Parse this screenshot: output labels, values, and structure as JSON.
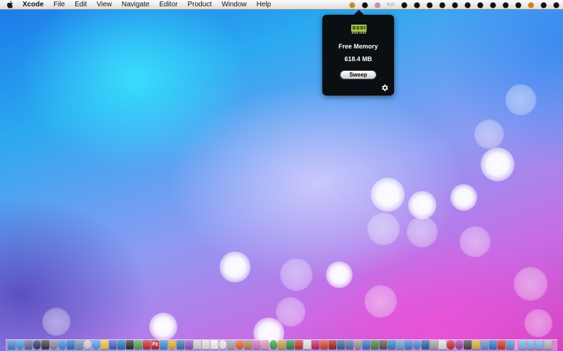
{
  "menubar": {
    "apple_icon": "apple-logo-icon",
    "items": [
      "Xcode",
      "File",
      "Edit",
      "View",
      "Navigate",
      "Editor",
      "Product",
      "Window",
      "Help"
    ],
    "status_icons": [
      {
        "name": "broom-sweep-icon",
        "color": "#c98a2a"
      },
      {
        "name": "cloud-icon",
        "color": "#111111"
      },
      {
        "name": "flower-icon",
        "color": "#c98fb0"
      },
      {
        "name": "h2o-icon",
        "glyph": "H₂O",
        "color": "#8a8a8a"
      },
      {
        "name": "wireless-broadcast-icon",
        "color": "#111111"
      },
      {
        "name": "box-icon",
        "color": "#111111"
      },
      {
        "name": "dropbox-icon",
        "color": "#111111"
      },
      {
        "name": "hand-icon",
        "color": "#111111"
      },
      {
        "name": "face-icon",
        "color": "#111111"
      },
      {
        "name": "eject-circle-icon",
        "color": "#111111"
      },
      {
        "name": "bluetooth-icon",
        "color": "#111111"
      },
      {
        "name": "battery-icon",
        "color": "#111111"
      },
      {
        "name": "binoculars-icon",
        "color": "#111111"
      },
      {
        "name": "wifi-icon",
        "color": "#111111"
      },
      {
        "name": "pen-icon",
        "color": "#d07a2a"
      },
      {
        "name": "user-circle-icon",
        "color": "#111111"
      },
      {
        "name": "spotlight-search-icon",
        "color": "#111111"
      }
    ]
  },
  "popover": {
    "icon": "ram-chip-icon",
    "accent_color": "#a6c24a",
    "title": "Free Memory",
    "value": "618.4 MB",
    "button_label": "Sweep",
    "settings_icon": "gear-icon"
  },
  "dock": {
    "icons": [
      {
        "name": "finder-icon",
        "color": "#4a7fd0",
        "glyph": ""
      },
      {
        "name": "safari-icon",
        "color": "#3c9ae0",
        "glyph": "",
        "round": true
      },
      {
        "name": "rocket-icon",
        "color": "#5a6a90",
        "glyph": ""
      },
      {
        "name": "launchpad-icon",
        "color": "#2a3560",
        "glyph": "",
        "round": true
      },
      {
        "name": "ios-simulator-icon",
        "color": "#333333",
        "glyph": ""
      },
      {
        "name": "system-preferences-icon",
        "color": "#888888",
        "glyph": "",
        "round": true
      },
      {
        "name": "itunes-icon",
        "color": "#3d88e0",
        "glyph": "",
        "round": true
      },
      {
        "name": "xcode-icon",
        "color": "#2a6fc0",
        "glyph": ""
      },
      {
        "name": "mail-icon",
        "color": "#6f8fb0",
        "glyph": ""
      },
      {
        "name": "clock-icon",
        "color": "#d0d0d0",
        "glyph": "",
        "round": true
      },
      {
        "name": "ichat-icon",
        "color": "#40a0e8",
        "glyph": "",
        "round": true
      },
      {
        "name": "notes-icon",
        "color": "#f0c040",
        "glyph": ""
      },
      {
        "name": "pencil-app-icon",
        "color": "#4060c0",
        "glyph": ""
      },
      {
        "name": "pen-app-icon",
        "color": "#2070c0",
        "glyph": ""
      },
      {
        "name": "terminal-icon",
        "color": "#2a2a2a",
        "glyph": ""
      },
      {
        "name": "utility-app-icon",
        "color": "#50a050",
        "glyph": ""
      },
      {
        "name": "calendar-app-icon",
        "color": "#c02a2a",
        "glyph": ""
      },
      {
        "name": "filezilla-icon",
        "color": "#c02020",
        "glyph": "Fz"
      },
      {
        "name": "image-app-icon",
        "color": "#3a8ad0",
        "glyph": ""
      },
      {
        "name": "chrome-icon",
        "color": "#e0b020",
        "glyph": "",
        "round": true
      },
      {
        "name": "photo-app-icon",
        "color": "#4070a0",
        "glyph": ""
      },
      {
        "name": "purple-app-icon",
        "color": "#8a50c0",
        "glyph": ""
      },
      {
        "name": "preview-icon",
        "color": "#d0d0d0",
        "glyph": ""
      },
      {
        "name": "mp3-app-icon",
        "color": "#e0e0e0",
        "glyph": ""
      },
      {
        "name": "textedit-icon",
        "color": "#f0f0f0",
        "glyph": ""
      },
      {
        "name": "skull-app-icon",
        "color": "#e8e8e8",
        "glyph": "",
        "round": true
      },
      {
        "name": "camera-app-icon",
        "color": "#a0a0a0",
        "glyph": ""
      },
      {
        "name": "firefox-icon",
        "color": "#e06020",
        "glyph": "",
        "round": true
      },
      {
        "name": "dictionary-icon",
        "color": "#b08050",
        "glyph": ""
      },
      {
        "name": "flower-app-icon",
        "color": "#d070c0",
        "glyph": ""
      },
      {
        "name": "sparkle-app-icon",
        "color": "#e090c0",
        "glyph": ""
      },
      {
        "name": "google-chrome-icon",
        "color": "#3aa040",
        "glyph": "",
        "round": true
      },
      {
        "name": "coda-icon",
        "color": "#c0a040",
        "glyph": ""
      },
      {
        "name": "chat-app-icon",
        "color": "#2a8a40",
        "glyph": ""
      },
      {
        "name": "red-app-icon",
        "color": "#c03020",
        "glyph": ""
      },
      {
        "name": "document-icon",
        "color": "#e0e0e0",
        "glyph": ""
      },
      {
        "name": "lotus-app-icon",
        "color": "#c02060",
        "glyph": ""
      },
      {
        "name": "paint-app-icon",
        "color": "#d04030",
        "glyph": ""
      },
      {
        "name": "photo-booth-icon",
        "color": "#a02020",
        "glyph": ""
      },
      {
        "name": "stack-app-icon",
        "color": "#3060a0",
        "glyph": ""
      },
      {
        "name": "figure-app-icon",
        "color": "#5070a0",
        "glyph": ""
      },
      {
        "name": "webcam-icon",
        "color": "#909090",
        "glyph": "",
        "round": true
      },
      {
        "name": "network-app-icon",
        "color": "#3070c0",
        "glyph": ""
      },
      {
        "name": "book-app-icon",
        "color": "#408040",
        "glyph": ""
      },
      {
        "name": "hub-app-icon",
        "color": "#505050",
        "glyph": ""
      },
      {
        "name": "vpn-app-icon",
        "color": "#3080c0",
        "glyph": ""
      },
      {
        "name": "snowflake-app-icon",
        "color": "#60a0d0",
        "glyph": ""
      },
      {
        "name": "cloud-app-icon",
        "color": "#4080d0",
        "glyph": ""
      },
      {
        "name": "sync-app-icon",
        "color": "#3a8ad0",
        "glyph": "",
        "round": true
      },
      {
        "name": "shield-app-icon",
        "color": "#2060a0",
        "glyph": ""
      },
      {
        "name": "puzzle-app-icon",
        "color": "#a0a0a0",
        "glyph": ""
      },
      {
        "name": "pause-app-icon",
        "color": "#e0e0e0",
        "glyph": ""
      },
      {
        "name": "red-disc-icon",
        "color": "#c02a2a",
        "glyph": "",
        "round": true
      },
      {
        "name": "purple-circle-app-icon",
        "color": "#9040a0",
        "glyph": "",
        "round": true
      },
      {
        "name": "monitor-app-icon",
        "color": "#404040",
        "glyph": ""
      },
      {
        "name": "tape-app-icon",
        "color": "#d0b040",
        "glyph": ""
      },
      {
        "name": "archive-app-icon",
        "color": "#6090c0",
        "glyph": ""
      },
      {
        "name": "blue-app-icon",
        "color": "#3070d0",
        "glyph": ""
      },
      {
        "name": "weibo-app-icon",
        "color": "#d03020",
        "glyph": ""
      },
      {
        "name": "code-app-icon",
        "color": "#5090d0",
        "glyph": ""
      },
      {
        "name": "folder-icon",
        "color": "#7ab0e0",
        "glyph": ""
      },
      {
        "name": "applications-folder-icon",
        "color": "#7ab0e0",
        "glyph": ""
      },
      {
        "name": "downloads-folder-icon",
        "color": "#7ab0e0",
        "glyph": ""
      },
      {
        "name": "trash-icon",
        "color": "#b0b0b8",
        "glyph": ""
      }
    ]
  }
}
